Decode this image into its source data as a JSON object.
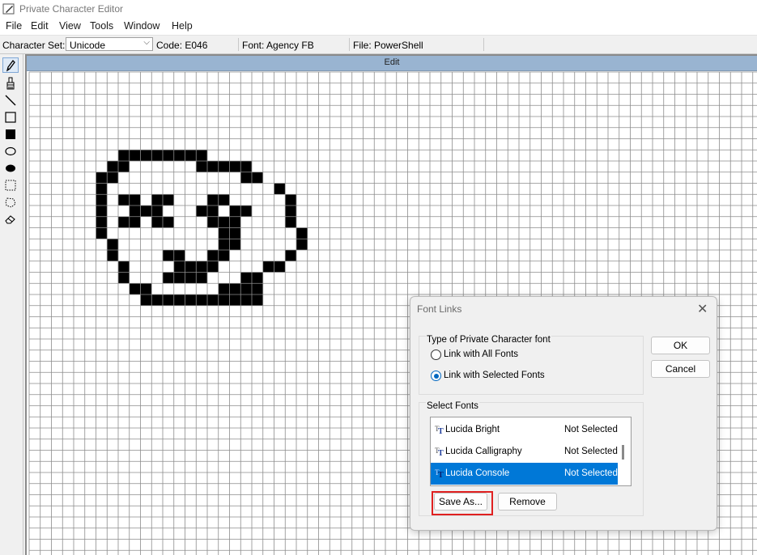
{
  "window": {
    "title": "Private Character Editor"
  },
  "menu": [
    "File",
    "Edit",
    "View",
    "Tools",
    "Window",
    "Help"
  ],
  "infobar": {
    "charset_label": "Character Set:",
    "charset_value": "Unicode",
    "code": "Code: E046",
    "font": "Font: Agency FB",
    "file": "File: PowerShell"
  },
  "tools": [
    "pencil-icon",
    "brush-icon",
    "line-icon",
    "hollow-rectangle-icon",
    "filled-rectangle-icon",
    "hollow-ellipse-icon",
    "filled-ellipse-icon",
    "rectangular-selection-icon",
    "freeform-selection-icon",
    "eraser-icon"
  ],
  "edit": {
    "header": "Edit",
    "glyph_rows": [
      "",
      "",
      "",
      "",
      "",
      "",
      "...........",
      "........########",
      ".......##......#####",
      "......##...........##",
      "......#...............#",
      "......#.##.##...##.....#",
      "......#..###...##.##...#",
      "......#.##.##...###....#",
      "......#..........##.....#",
      ".......#.........##.....#",
      ".......#....##..##.....#",
      "........#....####....##",
      "........#...####...##",
      ".........##......####",
      "..........###########"
    ]
  },
  "dialog": {
    "title": "Font Links",
    "group1_title": "Type of Private Character font",
    "radio_all": "Link with All Fonts",
    "radio_selected": "Link with Selected Fonts",
    "selected_option": "radio_selected",
    "group2_title": "Select Fonts",
    "fonts": [
      {
        "name": "Lucida Bright",
        "status": "Not Selected"
      },
      {
        "name": "Lucida Calligraphy",
        "status": "Not Selected"
      },
      {
        "name": "Lucida Console",
        "status": "Not Selected"
      }
    ],
    "ok": "OK",
    "cancel": "Cancel",
    "save_as": "Save As...",
    "remove": "Remove"
  },
  "colors": {
    "header": "#99b4d1",
    "selection": "#0078d7",
    "highlight": "#e02020",
    "radio_accent": "#0067c0"
  }
}
